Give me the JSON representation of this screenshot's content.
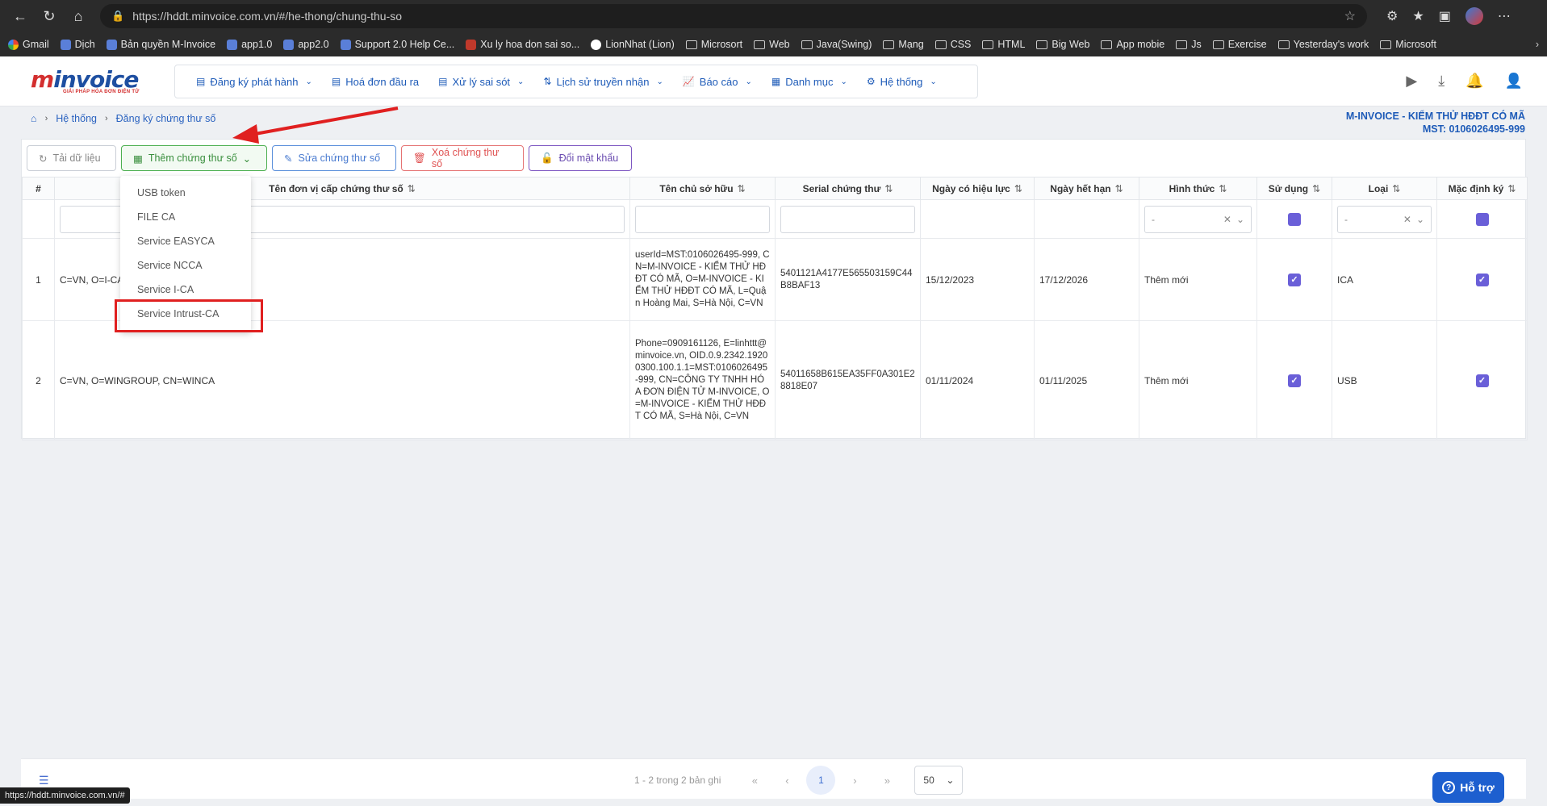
{
  "browser": {
    "url": "https://hddt.minvoice.com.vn/#/he-thong/chung-thu-so",
    "bookmarks": [
      "Gmail",
      "Dịch",
      "Bản quyền M-Invoice",
      "app1.0",
      "app2.0",
      "Support 2.0 Help Ce...",
      "Xu ly hoa don sai so...",
      "LionNhat (Lion)",
      "Microsort",
      "Web",
      "Java(Swing)",
      "Mạng",
      "CSS",
      "HTML",
      "Big Web",
      "App mobie",
      "Js",
      "Exercise",
      "Yesterday's work",
      "Microsoft"
    ],
    "status_url": "https://hddt.minvoice.com.vn/#"
  },
  "logo": {
    "text_main": "invoice",
    "prefix": "m",
    "tagline": "GIẢI PHÁP HÓA ĐƠN ĐIỆN TỬ"
  },
  "menu": [
    {
      "label": "Đăng ký phát hành",
      "has_caret": true
    },
    {
      "label": "Hoá đơn đầu ra",
      "has_caret": false
    },
    {
      "label": "Xử lý sai sót",
      "has_caret": true
    },
    {
      "label": "Lịch sử truyền nhận",
      "has_caret": true
    },
    {
      "label": "Báo cáo",
      "has_caret": true
    },
    {
      "label": "Danh mục",
      "has_caret": true
    },
    {
      "label": "Hệ thống",
      "has_caret": true
    }
  ],
  "breadcrumb": [
    "Hệ thống",
    "Đăng ký chứng thư số"
  ],
  "company": {
    "name": "M-INVOICE - KIỂM THỬ HĐĐT CÓ MÃ",
    "mst": "MST: 0106026495-999"
  },
  "toolbar": {
    "reload": "Tải dữ liệu",
    "add": "Thêm chứng thư số",
    "edit": "Sửa chứng thư số",
    "delete": "Xoá chứng thư số",
    "password": "Đổi mật khẩu"
  },
  "table": {
    "headers": [
      "#",
      "Tên đơn vị cấp chứng thư số",
      "Tên chủ sở hữu",
      "Serial chứng thư",
      "Ngày có hiệu lực",
      "Ngày hết hạn",
      "Hình thức",
      "Sử dụng",
      "Loại",
      "Mặc định ký"
    ],
    "filter_select_placeholder": "-",
    "rows": [
      {
        "no": "1",
        "issuer": "C=VN, O=I-CA",
        "owner": "userId=MST:0106026495-999, CN=M-INVOICE - KIỂM THỬ HĐĐT CÓ MÃ, O=M-INVOICE - KIỂM THỬ HĐĐT CÓ MÃ, L=Quận Hoàng Mai, S=Hà Nội, C=VN",
        "serial": "5401121A4177E565503159C44B8BAF13",
        "valid_from": "15/12/2023",
        "valid_to": "17/12/2026",
        "form": "Thêm mới",
        "in_use": true,
        "type": "ICA",
        "default_sign": true
      },
      {
        "no": "2",
        "issuer": "C=VN, O=WINGROUP, CN=WINCA",
        "owner": "Phone=0909161126, E=linhttt@minvoice.vn, OID.0.9.2342.19200300.100.1.1=MST:0106026495-999, CN=CÔNG TY TNHH HÓA ĐƠN ĐIỆN TỬ M-INVOICE, O=M-INVOICE - KIỂM THỬ HĐĐT CÓ MÃ, S=Hà Nội, C=VN",
        "serial": "54011658B615EA35FF0A301E28818E07",
        "valid_from": "01/11/2024",
        "valid_to": "01/11/2025",
        "form": "Thêm mới",
        "in_use": true,
        "type": "USB",
        "default_sign": true
      }
    ]
  },
  "dropdown": [
    "USB token",
    "FILE CA",
    "Service EASYCA",
    "Service NCCA",
    "Service I-CA",
    "Service Intrust-CA"
  ],
  "pager": {
    "info": "1 - 2 trong 2 bản ghi",
    "current": "1",
    "page_size": "50"
  },
  "support": "Hỗ trợ",
  "colors": {
    "primary": "#1e5bb8",
    "highlight": "#e02020",
    "checkbox": "#6a5fd8"
  }
}
